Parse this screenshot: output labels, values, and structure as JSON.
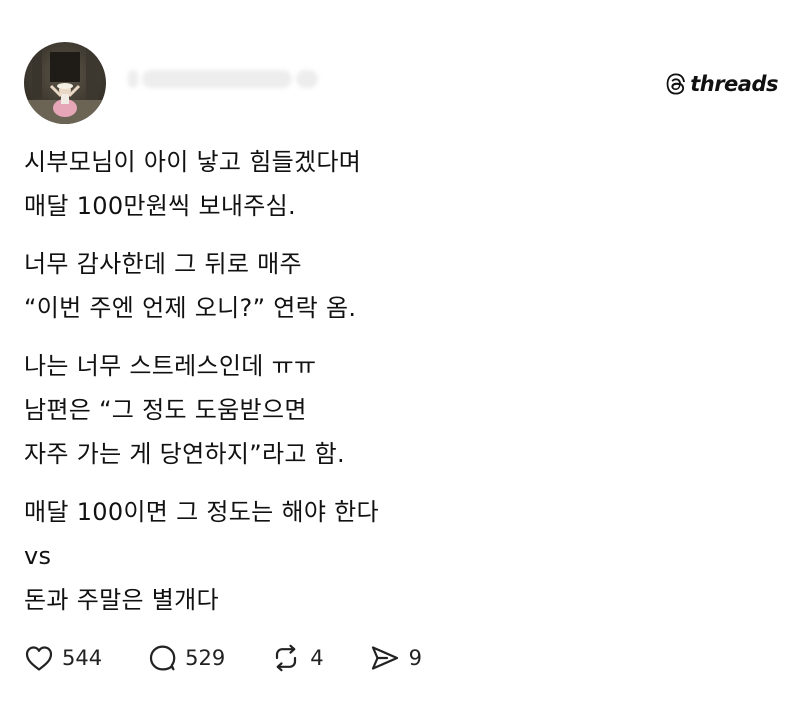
{
  "header": {
    "brand": "threads"
  },
  "post": {
    "paragraphs": [
      [
        "시부모님이 아이 낳고 힘들겠다며",
        "매달 100만원씩 보내주심."
      ],
      [
        "너무 감사한데 그 뒤로 매주",
        "“이번 주엔 언제 오니?” 연락 옴."
      ],
      [
        "나는 너무 스트레스인데 ㅠㅠ",
        "남편은 “그 정도 도움받으면",
        "자주 가는 게 당연하지”라고 함."
      ],
      [
        "매달 100이면 그 정도는 해야 한다",
        "vs",
        "돈과 주말은 별개다"
      ]
    ]
  },
  "actions": {
    "like_count": "544",
    "reply_count": "529",
    "repost_count": "4",
    "share_count": "9"
  },
  "icons": {
    "like": "heart-icon",
    "reply": "speech-bubble-icon",
    "repost": "repost-arrows-icon",
    "share": "send-arrow-icon",
    "brand": "threads-logo-icon"
  }
}
